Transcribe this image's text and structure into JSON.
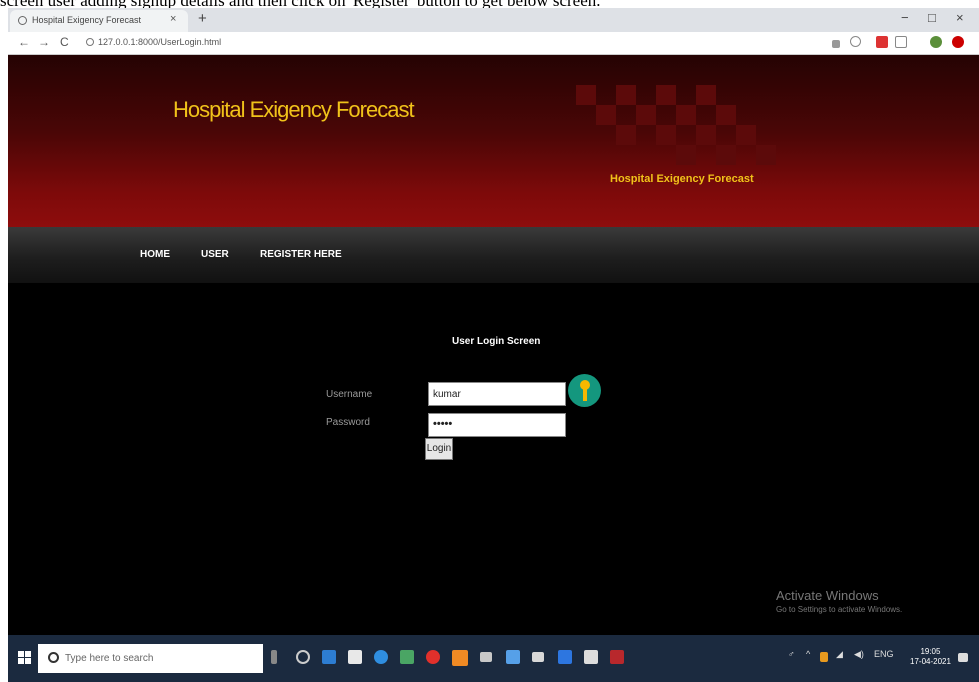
{
  "caption": "screen user adding signup details and then click on 'Register' button to get below screen.",
  "browser": {
    "tab_title": "Hospital Exigency Forecast",
    "tab_close": "×",
    "new_tab": "+",
    "url": "127.0.0.1:8000/UserLogin.html",
    "controls": {
      "minimize": "−",
      "maximize": "□",
      "close": "×"
    },
    "nav": {
      "back": "←",
      "forward": "→",
      "reload": "C"
    }
  },
  "site": {
    "title": "Hospital Exigency Forecast",
    "subtitle": "Hospital Exigency Forecast",
    "menu": [
      "HOME",
      "USER",
      "REGISTER HERE"
    ]
  },
  "login": {
    "heading": "User Login Screen",
    "username_label": "Username",
    "password_label": "Password",
    "username_value": "kumar",
    "password_value": "•••••",
    "button": "Login"
  },
  "watermark": {
    "line1": "Activate Windows",
    "line2": "Go to Settings to activate Windows."
  },
  "taskbar": {
    "search_placeholder": "Type here to search",
    "time": "19:05",
    "date": "17-04-2021"
  },
  "colors": {
    "header_dark": "#250303",
    "header_red": "#8e0d0d",
    "title_gold": "#f0c21a",
    "key_badge": "#14977e",
    "taskbar": "#1b2a3f"
  }
}
